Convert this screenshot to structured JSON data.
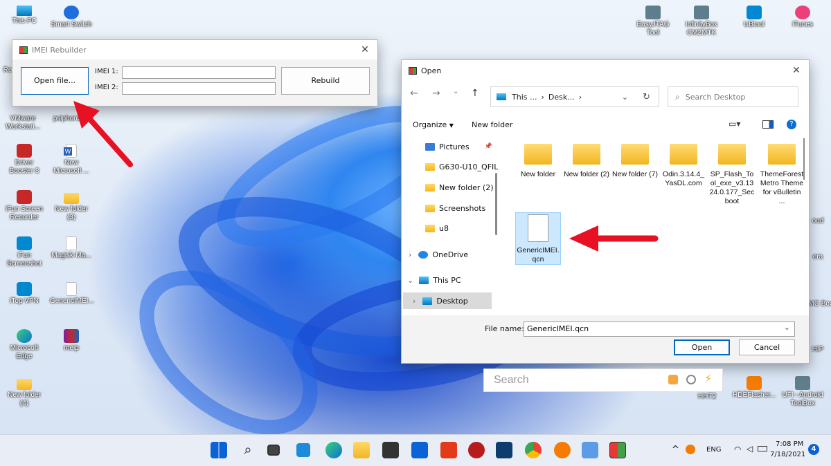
{
  "desktop": {
    "icons": [
      {
        "label": "This PC"
      },
      {
        "label": "Smart Switch"
      },
      {
        "label": "VMware Workstati..."
      },
      {
        "label": "psiphon3"
      },
      {
        "label": "Driver Booster 8"
      },
      {
        "label": "New Microsoft ..."
      },
      {
        "label": "iFun Screen Recorder"
      },
      {
        "label": "New folder (3)"
      },
      {
        "label": "iFun Screenshot"
      },
      {
        "label": "Magisk-Ma..."
      },
      {
        "label": "iTop VPN"
      },
      {
        "label": "GenericIMEI..."
      },
      {
        "label": "Microsoft Edge"
      },
      {
        "label": "meip"
      },
      {
        "label": "New folder (4)"
      },
      {
        "label": "EasyJTAG Tool"
      },
      {
        "label": "InfinityBox CM2MTK"
      },
      {
        "label": "UBtool"
      },
      {
        "label": "iTunes"
      },
      {
        "label": "HHT2"
      },
      {
        "label": "HDEFlasher..."
      },
      {
        "label": "UFI - Android ToolBox"
      }
    ],
    "partial_labels": [
      "Re",
      "oud",
      "era",
      "MMC Box",
      "HIP"
    ]
  },
  "imei_window": {
    "title": "IMEI Rebuilder",
    "open_button": "Open file...",
    "imei1_label": "IMEI 1:",
    "imei2_label": "IMEI 2:",
    "imei1_value": "",
    "imei2_value": "",
    "rebuild_button": "Rebuild"
  },
  "open_dialog": {
    "title": "Open",
    "breadcrumb": [
      "This ...",
      "Desk..."
    ],
    "search_placeholder": "Search Desktop",
    "organize": "Organize",
    "new_folder": "New folder",
    "tree": [
      {
        "label": "Pictures",
        "pinned": true
      },
      {
        "label": "G630-U10_QFIL"
      },
      {
        "label": "New folder (2)"
      },
      {
        "label": "Screenshots"
      },
      {
        "label": "u8"
      },
      {
        "label": "OneDrive"
      },
      {
        "label": "This PC"
      },
      {
        "label": "Desktop",
        "selected": true
      }
    ],
    "files": [
      {
        "name": "New folder"
      },
      {
        "name": "New folder (2)"
      },
      {
        "name": "New folder (7)"
      },
      {
        "name": "Odin.3.14.4_YasDL.com"
      },
      {
        "name": "SP_Flash_Tool_exe_v3.1324.0.177_Secboot"
      },
      {
        "name": "ThemeForest Metro Theme for vBulletin ..."
      },
      {
        "name": "GenericIMEI.qcn",
        "selected": true
      }
    ],
    "file_name_label": "File name:",
    "file_name_value": "GenericIMEI.qcn",
    "open_button": "Open",
    "cancel_button": "Cancel"
  },
  "search_box": {
    "placeholder": "Search"
  },
  "taskbar": {
    "apps": [
      "start-icon",
      "search-icon",
      "task-view-icon",
      "widgets-icon",
      "edge-icon",
      "file-explorer-icon",
      "store-icon",
      "mail-icon",
      "office-icon",
      "app-red-icon",
      "vpn-icon",
      "chrome-icon",
      "key-icon",
      "photos-icon",
      "imei-rebuilder-icon"
    ],
    "language": "ENG",
    "time": "7:08 PM",
    "date": "7/18/2021",
    "notification_count": "4"
  },
  "colors": {
    "accent": "#0067c0",
    "arrow": "#e81123",
    "selection": "#cce8ff"
  }
}
